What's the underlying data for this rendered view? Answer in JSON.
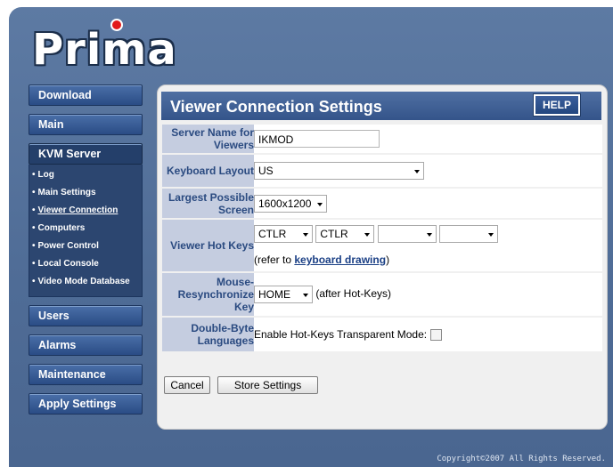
{
  "brand": {
    "logo_text": "Prima"
  },
  "sidebar": {
    "download": "Download",
    "main": "Main",
    "kvm_server": "KVM Server",
    "kvm_items": [
      "Log",
      "Main Settings",
      "Viewer Connection",
      "Computers",
      "Power Control",
      "Local Console",
      "Video Mode Database"
    ],
    "users": "Users",
    "alarms": "Alarms",
    "maintenance": "Maintenance",
    "apply_settings": "Apply Settings"
  },
  "panel": {
    "title": "Viewer Connection Settings",
    "help": "HELP"
  },
  "fields": {
    "server_name": {
      "label": "Server Name for Viewers",
      "value": "IKMOD"
    },
    "keyboard_layout": {
      "label": "Keyboard Layout",
      "value": "US"
    },
    "largest_screen": {
      "label": "Largest Possible Screen",
      "value": "1600x1200"
    },
    "hot_keys": {
      "label": "Viewer Hot Keys",
      "key1": "CTLR",
      "key2": "CTLR",
      "key3": "",
      "key4": "",
      "refer_prefix": "(refer to ",
      "refer_link": "keyboard drawing",
      "refer_suffix": ")"
    },
    "resync_key": {
      "label": "Mouse-Resynchronize Key",
      "value": "HOME",
      "suffix": "(after Hot-Keys)"
    },
    "double_byte": {
      "label": "Double-Byte Languages",
      "text": "Enable Hot-Keys Transparent Mode:",
      "checked": false
    }
  },
  "buttons": {
    "cancel": "Cancel",
    "store": "Store Settings"
  },
  "footer": {
    "copyright": "Copyright©2007  All Rights Reserved."
  }
}
